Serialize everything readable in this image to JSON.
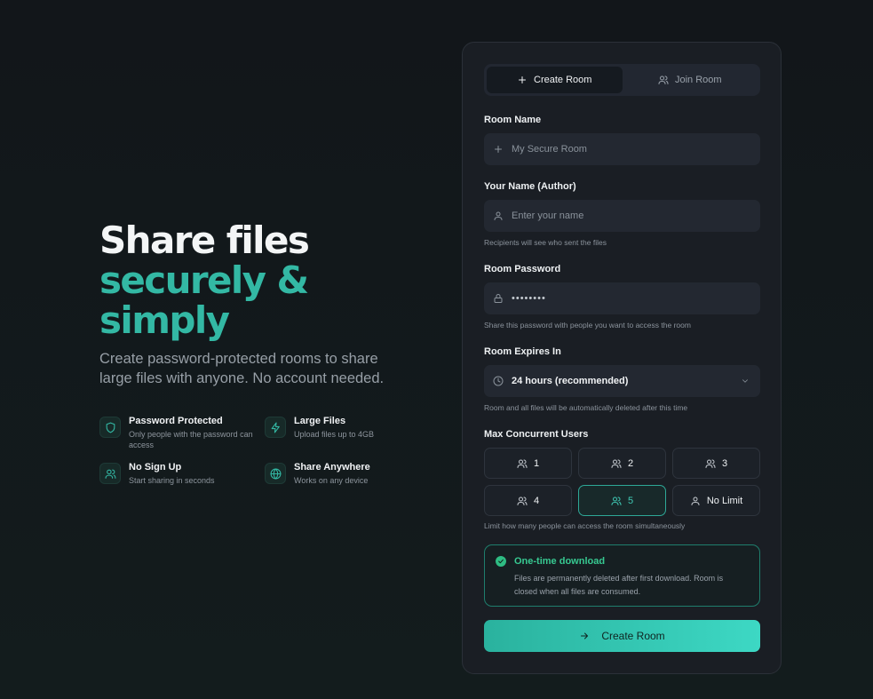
{
  "hero": {
    "title_line1": "Share files",
    "title_line2": "securely &",
    "title_line3": "simply",
    "subtitle": "Create password-protected rooms to share large files with anyone. No account needed."
  },
  "features": [
    {
      "icon": "shield-icon",
      "title": "Password Protected",
      "desc": "Only people with the password can access"
    },
    {
      "icon": "lightning-icon",
      "title": "Large Files",
      "desc": "Upload files up to 4GB"
    },
    {
      "icon": "users-icon",
      "title": "No Sign Up",
      "desc": "Start sharing in seconds"
    },
    {
      "icon": "globe-icon",
      "title": "Share Anywhere",
      "desc": "Works on any device"
    }
  ],
  "tabs": {
    "create": "Create Room",
    "join": "Join Room",
    "active": "create"
  },
  "form": {
    "room_name": {
      "label": "Room Name",
      "placeholder": "My Secure Room",
      "value": ""
    },
    "author": {
      "label": "Your Name (Author)",
      "placeholder": "Enter your name",
      "value": "",
      "help": "Recipients will see who sent the files"
    },
    "password": {
      "label": "Room Password",
      "value": "••••••••",
      "help": "Share this password with people you want to access the room"
    },
    "expires": {
      "label": "Room Expires In",
      "value": "24 hours (recommended)",
      "help": "Room and all files will be automatically deleted after this time"
    },
    "max_users": {
      "label": "Max Concurrent Users",
      "options": [
        "1",
        "2",
        "3",
        "4",
        "5",
        "No Limit"
      ],
      "selected": "5",
      "help": "Limit how many people can access the room simultaneously"
    },
    "one_time": {
      "title": "One-time download",
      "desc": "Files are permanently deleted after first download. Room is closed when all files are consumed.",
      "checked": true
    },
    "submit_label": "Create Room"
  },
  "colors": {
    "accent": "#33b8a4",
    "success": "#37c991",
    "background": "#12161a",
    "card": "#1a1e24"
  }
}
